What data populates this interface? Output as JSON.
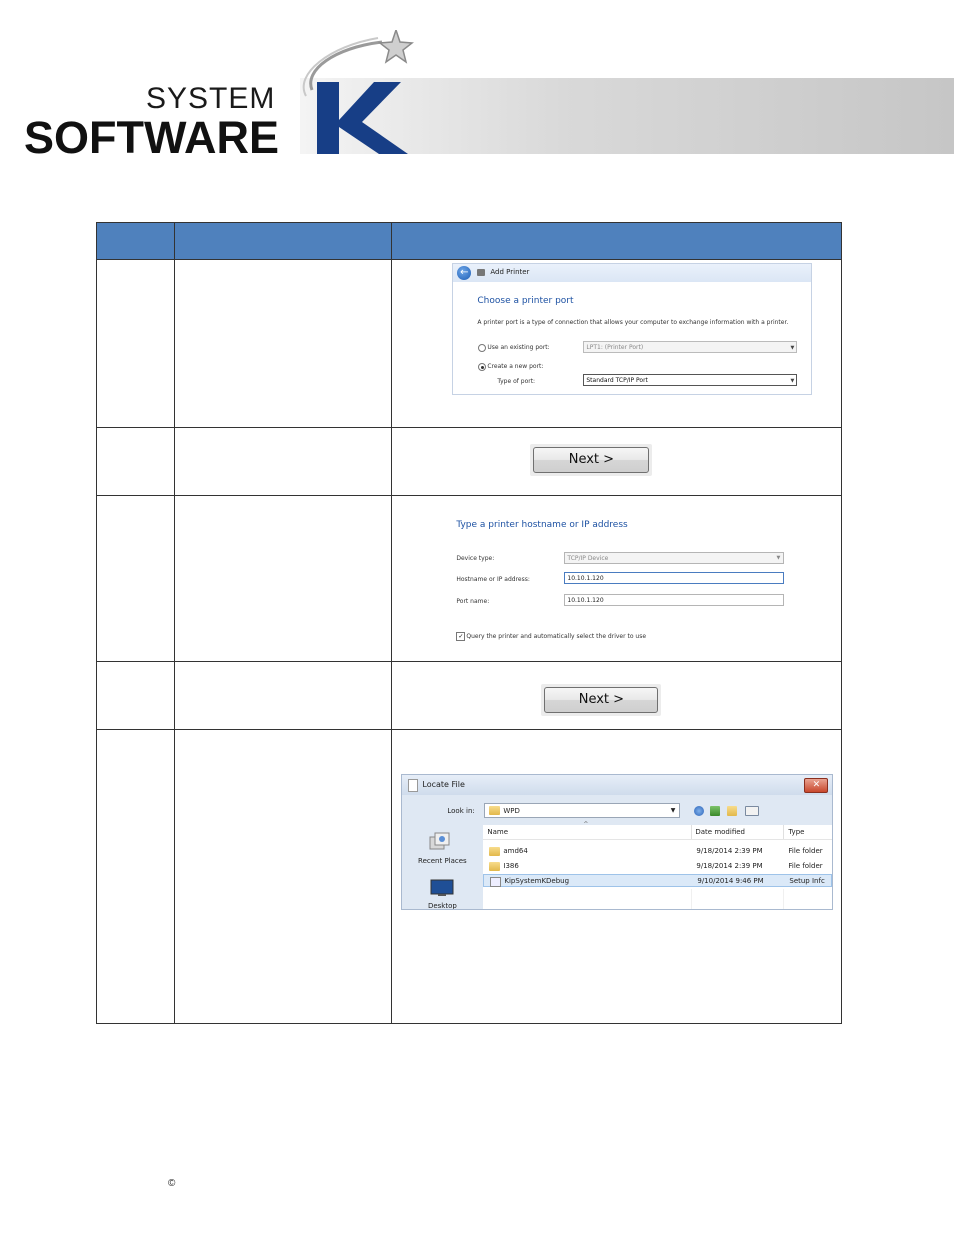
{
  "logo": {
    "line1": "SYSTEM",
    "line2": "SOFTWARE",
    "letter": "K"
  },
  "table": {
    "headers": [
      "",
      "",
      ""
    ],
    "rows": [
      {
        "step": "",
        "action": "",
        "image": "add-printer-port-dialog"
      },
      {
        "step": "",
        "action": "",
        "image": "next-button"
      },
      {
        "step": "",
        "action": "",
        "image": "tcpip-hostname-dialog"
      },
      {
        "step": "",
        "action": "",
        "image": "next-button"
      },
      {
        "step": "",
        "action": "",
        "image": "locate-file-dialog"
      }
    ]
  },
  "add_printer": {
    "title": "Add Printer",
    "heading": "Choose a printer port",
    "description": "A printer port is a type of connection that allows your computer to exchange information with a printer.",
    "option_existing": "Use an existing port:",
    "existing_value": "LPT1: (Printer Port)",
    "option_new": "Create a new port:",
    "type_label": "Type of port:",
    "type_value": "Standard TCP/IP Port"
  },
  "next_button": {
    "label": "Next >"
  },
  "tcpip": {
    "heading": "Type a printer hostname or IP address",
    "device_type_label": "Device type:",
    "device_type_value": "TCP/IP Device",
    "hostname_label": "Hostname or IP address:",
    "hostname_value": "10.10.1.120",
    "port_name_label": "Port name:",
    "port_name_value": "10.10.1.120",
    "query_label": "Query the printer and automatically select the driver to use"
  },
  "locate_file": {
    "title": "Locate File",
    "look_in_label": "Look in:",
    "look_in_value": "WPD",
    "places": [
      {
        "label": "Recent Places",
        "icon": "recent-places-icon"
      },
      {
        "label": "Desktop",
        "icon": "desktop-icon"
      }
    ],
    "columns": [
      "Name",
      "Date modified",
      "Type"
    ],
    "rows": [
      {
        "name": "amd64",
        "date": "9/18/2014 2:39 PM",
        "type": "File folder",
        "icon": "folder-icon"
      },
      {
        "name": "I386",
        "date": "9/18/2014 2:39 PM",
        "type": "File folder",
        "icon": "folder-icon"
      },
      {
        "name": "KipSystemKDebug",
        "date": "9/10/2014 9:46 PM",
        "type": "Setup Infc",
        "icon": "setup-file-icon"
      }
    ]
  },
  "footer": {
    "copyright": "©"
  },
  "colors": {
    "header_blue": "#4f81bd",
    "link_blue": "#1e52a3"
  }
}
